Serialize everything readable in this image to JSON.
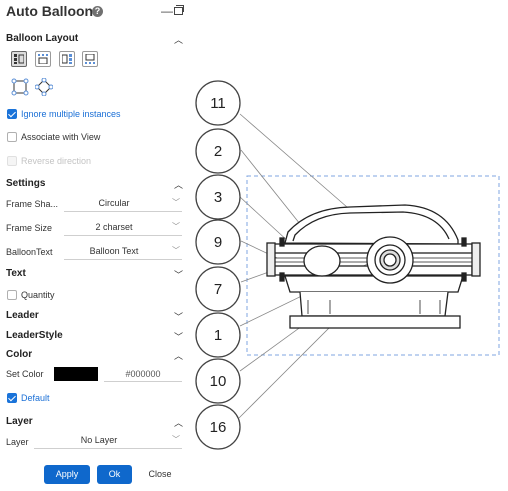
{
  "panel": {
    "title": "Auto Balloon",
    "help_icon": "?",
    "sections": {
      "balloon_layout": "Balloon Layout",
      "settings": "Settings",
      "text": "Text",
      "leader": "Leader",
      "leader_style": "LeaderStyle",
      "color": "Color",
      "layer": "Layer"
    },
    "options": {
      "ignore_multiple": "Ignore multiple instances",
      "associate_view": "Associate with View",
      "reverse_direction": "Reverse direction",
      "quantity": "Quantity",
      "default": "Default"
    },
    "fields": {
      "frame_shape_label": "Frame Sha...",
      "frame_shape_value": "Circular",
      "frame_size_label": "Frame Size",
      "frame_size_value": "2 charset",
      "balloon_text_label": "BalloonText",
      "balloon_text_value": "Balloon Text",
      "set_color_label": "Set Color",
      "color_hex": "#000000",
      "layer_label": "Layer",
      "layer_value": "No Layer"
    },
    "buttons": {
      "apply": "Apply",
      "ok": "Ok",
      "close": "Close"
    },
    "colors": {
      "accent": "#0f68cc",
      "swatch": "#000000"
    }
  },
  "drawing": {
    "balloons": [
      "11",
      "2",
      "3",
      "9",
      "7",
      "1",
      "10",
      "16"
    ]
  }
}
